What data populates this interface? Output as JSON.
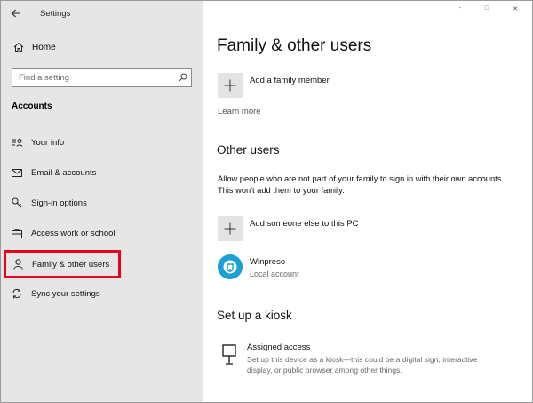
{
  "window": {
    "title": "Settings",
    "controls": [
      "-",
      "□",
      "✕"
    ]
  },
  "sidebar": {
    "home_label": "Home",
    "search_placeholder": "Find a setting",
    "section_title": "Accounts",
    "items": [
      {
        "label": "Your info",
        "icon": "person-card-icon"
      },
      {
        "label": "Email & accounts",
        "icon": "mail-icon"
      },
      {
        "label": "Sign-in options",
        "icon": "key-icon"
      },
      {
        "label": "Access work or school",
        "icon": "briefcase-icon"
      },
      {
        "label": "Family & other users",
        "icon": "person-icon",
        "active": true
      },
      {
        "label": "Sync your settings",
        "icon": "sync-icon"
      }
    ]
  },
  "main": {
    "title": "Family & other users",
    "add_family_label": "Add a family member",
    "learn_more": "Learn more",
    "other_users_title": "Other users",
    "other_users_desc": "Allow people who are not part of your family to sign in with their own accounts. This won't add them to your family.",
    "add_someone_label": "Add someone else to this PC",
    "user": {
      "name": "Winpreso",
      "type": "Local account"
    },
    "kiosk_title": "Set up a kiosk",
    "assigned_access_title": "Assigned access",
    "assigned_access_desc": "Set up this device as a kiosk—this could be a digital sign, interactive display, or public browser among other things."
  },
  "colors": {
    "sidebar_bg": "#e6e6e6",
    "highlight": "#e8001c",
    "avatar": "#1a9fd6",
    "tile": "#e3e3e3"
  }
}
